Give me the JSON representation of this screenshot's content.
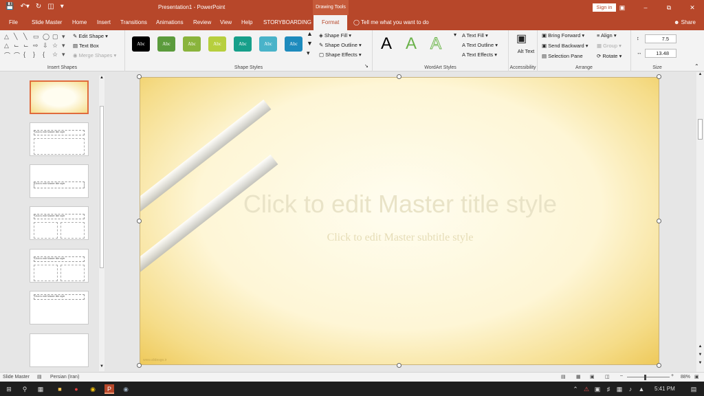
{
  "app": {
    "window_title": "Presentation1 - PowerPoint",
    "context_tab_group": "Drawing Tools",
    "sign_in": "Sign in",
    "share": "Share",
    "tell_me": "Tell me what you want to do"
  },
  "tabs": [
    "File",
    "Slide Master",
    "Home",
    "Insert",
    "Transitions",
    "Animations",
    "Review",
    "View",
    "Help",
    "STORYBOARDING",
    "Format"
  ],
  "active_tab": "Format",
  "ribbon": {
    "insert_shapes": {
      "label": "Insert Shapes",
      "edit_shape": "Edit Shape",
      "text_box": "Text Box",
      "merge_shapes": "Merge Shapes"
    },
    "shape_styles": {
      "label": "Shape Styles",
      "swatch_text": "Abc",
      "swatch_colors": [
        "#000000",
        "#5b9b3c",
        "#8ab43c",
        "#b7cf3e",
        "#179f8a",
        "#49b3c9",
        "#1e8bbd"
      ],
      "shape_fill": "Shape Fill",
      "shape_outline": "Shape Outline",
      "shape_effects": "Shape Effects"
    },
    "wordart_styles": {
      "label": "WordArt Styles",
      "letter": "A",
      "text_fill": "Text Fill",
      "text_outline": "Text Outline",
      "text_effects": "Text Effects"
    },
    "accessibility": {
      "label": "Accessibility",
      "alt_text": "Alt Text"
    },
    "arrange": {
      "label": "Arrange",
      "bring_forward": "Bring Forward",
      "send_backward": "Send Backward",
      "selection_pane": "Selection Pane",
      "align": "Align",
      "group": "Group",
      "rotate": "Rotate"
    },
    "size": {
      "label": "Size",
      "height": "7.5",
      "width": "13.48"
    }
  },
  "thumbnails": {
    "title_text": "Click to edit Master title style"
  },
  "slide": {
    "title_placeholder": "Click to edit Master title style",
    "subtitle_placeholder": "Click to edit Master subtitle style",
    "watermark": "www.slidesgo.ir"
  },
  "status": {
    "view": "Slide Master",
    "language": "Persian (Iran)",
    "zoom": "88%"
  },
  "taskbar": {
    "time": "5:41 PM"
  }
}
